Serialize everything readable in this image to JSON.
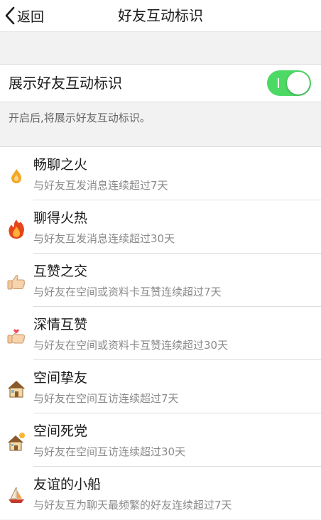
{
  "nav": {
    "back_label": "返回",
    "title": "好友互动标识"
  },
  "toggle": {
    "label": "展示好友互动标识",
    "on": true,
    "color": "#4cd964"
  },
  "description": "开启后,将展示好友互动标识。",
  "items": [
    {
      "icon": "small-flame-icon",
      "title": "畅聊之火",
      "subtitle": "与好友互发消息连续超过7天"
    },
    {
      "icon": "big-flame-icon",
      "title": "聊得火热",
      "subtitle": "与好友互发消息连续超过30天"
    },
    {
      "icon": "thumbs-up-icon",
      "title": "互赞之交",
      "subtitle": "与好友在空间或资料卡互赞连续超过7天"
    },
    {
      "icon": "thumbs-up-heart-icon",
      "title": "深情互赞",
      "subtitle": "与好友在空间或资料卡互赞连续超过30天"
    },
    {
      "icon": "house-icon",
      "title": "空间挚友",
      "subtitle": "与好友在空间互访连续超过7天"
    },
    {
      "icon": "house-sun-icon",
      "title": "空间死党",
      "subtitle": "与好友在空间互访连续超过30天"
    },
    {
      "icon": "sailboat-icon",
      "title": "友谊的小船",
      "subtitle": "与好友互为聊天最频繁的好友连续超过7天"
    }
  ]
}
